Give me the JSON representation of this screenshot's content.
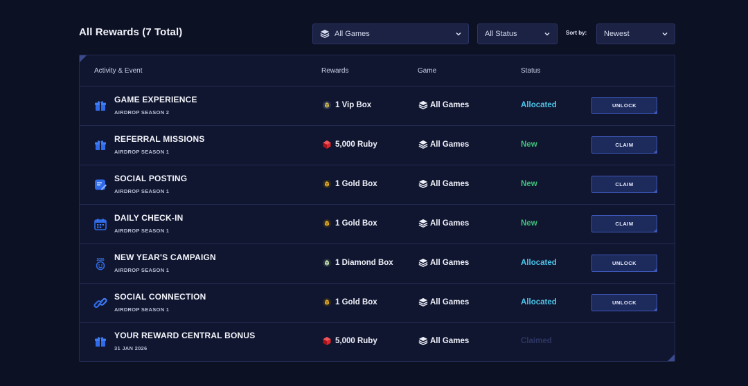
{
  "header": {
    "title": "All Rewards (7 Total)",
    "games_filter": "All Games",
    "status_filter": "All Status",
    "sort_label": "Sort by:",
    "sort_value": "Newest"
  },
  "table": {
    "columns": {
      "activity": "Activity & Event",
      "rewards": "Rewards",
      "game": "Game",
      "status": "Status"
    },
    "rows": [
      {
        "icon": "gift-icon",
        "title": "GAME EXPERIENCE",
        "subtitle": "AIRDROP SEASON 2",
        "reward_icon": "vip-box-icon",
        "reward": "1 Vip Box",
        "game": "All Games",
        "status": "Allocated",
        "action": "UNLOCK"
      },
      {
        "icon": "gift-icon",
        "title": "REFERRAL MISSIONS",
        "subtitle": "AIRDROP SEASON 1",
        "reward_icon": "ruby-icon",
        "reward": "5,000 Ruby",
        "game": "All Games",
        "status": "New",
        "action": "CLAIM"
      },
      {
        "icon": "post-icon",
        "title": "SOCIAL POSTING",
        "subtitle": "AIRDROP SEASON 1",
        "reward_icon": "gold-box-icon",
        "reward": "1 Gold Box",
        "game": "All Games",
        "status": "New",
        "action": "CLAIM"
      },
      {
        "icon": "calendar-icon",
        "title": "DAILY CHECK-IN",
        "subtitle": "AIRDROP SEASON 1",
        "reward_icon": "gold-box-icon",
        "reward": "1 Gold Box",
        "game": "All Games",
        "status": "New",
        "action": "CLAIM"
      },
      {
        "icon": "new-year-icon",
        "title": "NEW YEAR'S CAMPAIGN",
        "subtitle": "AIRDROP SEASON 1",
        "reward_icon": "diamond-box-icon",
        "reward": "1 Diamond Box",
        "game": "All Games",
        "status": "Allocated",
        "action": "UNLOCK"
      },
      {
        "icon": "link-icon",
        "title": "SOCIAL CONNECTION",
        "subtitle": "AIRDROP SEASON 1",
        "reward_icon": "gold-box-icon",
        "reward": "1 Gold Box",
        "game": "All Games",
        "status": "Allocated",
        "action": "UNLOCK"
      },
      {
        "icon": "gift-icon",
        "title": "YOUR REWARD CENTRAL BONUS",
        "subtitle": "31 JAN 2026",
        "reward_icon": "ruby-icon",
        "reward": "5,000 Ruby",
        "game": "All Games",
        "status": "Claimed",
        "action": ""
      }
    ]
  },
  "colors": {
    "background": "#0d1124",
    "panel": "#111630",
    "allocated": "#4cc6ea",
    "new": "#3fc27a",
    "claimed": "#2c3663",
    "accent": "#2a5fe0"
  }
}
